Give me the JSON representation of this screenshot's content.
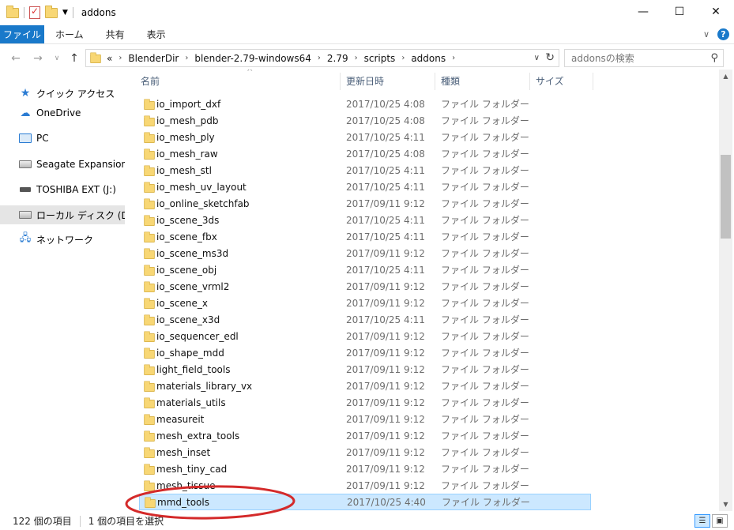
{
  "window": {
    "title": "addons",
    "controls": [
      "minimize-icon",
      "maximize-icon",
      "close-icon"
    ]
  },
  "ribbon": {
    "tabs": [
      "ファイル",
      "ホーム",
      "共有",
      "表示"
    ]
  },
  "address": {
    "overflow": "«",
    "crumbs": [
      "BlenderDir",
      "blender-2.79-windows64",
      "2.79",
      "scripts",
      "addons"
    ],
    "search_placeholder": "addonsの検索"
  },
  "nav_pane": {
    "items": [
      {
        "label": "クイック アクセス",
        "icon": "star-icon"
      },
      {
        "label": "OneDrive",
        "icon": "cloud-icon"
      },
      {
        "label": "PC",
        "icon": "pc-icon"
      },
      {
        "label": "Seagate Expansion Dri",
        "icon": "drive-icon"
      },
      {
        "label": "TOSHIBA EXT (J:)",
        "icon": "usb-drive-icon"
      },
      {
        "label": "ローカル ディスク (D:)",
        "icon": "drive-icon",
        "selected": true
      },
      {
        "label": "ネットワーク",
        "icon": "network-icon"
      }
    ]
  },
  "columns": {
    "name": "名前",
    "date": "更新日時",
    "type": "種類",
    "size": "サイズ"
  },
  "files": [
    {
      "name": "io_import_dxf",
      "date": "2017/10/25 4:08",
      "type": "ファイル フォルダー"
    },
    {
      "name": "io_mesh_pdb",
      "date": "2017/10/25 4:08",
      "type": "ファイル フォルダー"
    },
    {
      "name": "io_mesh_ply",
      "date": "2017/10/25 4:11",
      "type": "ファイル フォルダー"
    },
    {
      "name": "io_mesh_raw",
      "date": "2017/10/25 4:08",
      "type": "ファイル フォルダー"
    },
    {
      "name": "io_mesh_stl",
      "date": "2017/10/25 4:11",
      "type": "ファイル フォルダー"
    },
    {
      "name": "io_mesh_uv_layout",
      "date": "2017/10/25 4:11",
      "type": "ファイル フォルダー"
    },
    {
      "name": "io_online_sketchfab",
      "date": "2017/09/11 9:12",
      "type": "ファイル フォルダー"
    },
    {
      "name": "io_scene_3ds",
      "date": "2017/10/25 4:11",
      "type": "ファイル フォルダー"
    },
    {
      "name": "io_scene_fbx",
      "date": "2017/10/25 4:11",
      "type": "ファイル フォルダー"
    },
    {
      "name": "io_scene_ms3d",
      "date": "2017/09/11 9:12",
      "type": "ファイル フォルダー"
    },
    {
      "name": "io_scene_obj",
      "date": "2017/10/25 4:11",
      "type": "ファイル フォルダー"
    },
    {
      "name": "io_scene_vrml2",
      "date": "2017/09/11 9:12",
      "type": "ファイル フォルダー"
    },
    {
      "name": "io_scene_x",
      "date": "2017/09/11 9:12",
      "type": "ファイル フォルダー"
    },
    {
      "name": "io_scene_x3d",
      "date": "2017/10/25 4:11",
      "type": "ファイル フォルダー"
    },
    {
      "name": "io_sequencer_edl",
      "date": "2017/09/11 9:12",
      "type": "ファイル フォルダー"
    },
    {
      "name": "io_shape_mdd",
      "date": "2017/09/11 9:12",
      "type": "ファイル フォルダー"
    },
    {
      "name": "light_field_tools",
      "date": "2017/09/11 9:12",
      "type": "ファイル フォルダー"
    },
    {
      "name": "materials_library_vx",
      "date": "2017/09/11 9:12",
      "type": "ファイル フォルダー"
    },
    {
      "name": "materials_utils",
      "date": "2017/09/11 9:12",
      "type": "ファイル フォルダー"
    },
    {
      "name": "measureit",
      "date": "2017/09/11 9:12",
      "type": "ファイル フォルダー"
    },
    {
      "name": "mesh_extra_tools",
      "date": "2017/09/11 9:12",
      "type": "ファイル フォルダー"
    },
    {
      "name": "mesh_inset",
      "date": "2017/09/11 9:12",
      "type": "ファイル フォルダー"
    },
    {
      "name": "mesh_tiny_cad",
      "date": "2017/09/11 9:12",
      "type": "ファイル フォルダー"
    },
    {
      "name": "mesh_tissue",
      "date": "2017/09/11 9:12",
      "type": "ファイル フォルダー"
    },
    {
      "name": "mmd_tools",
      "date": "2017/10/25 4:40",
      "type": "ファイル フォルダー",
      "selected": true
    }
  ],
  "status": {
    "item_count": "122 個の項目",
    "selected": "1 個の項目を選択"
  },
  "colors": {
    "accent": "#1979ca",
    "selection": "#cce8ff",
    "annotation": "#d42a2a"
  }
}
